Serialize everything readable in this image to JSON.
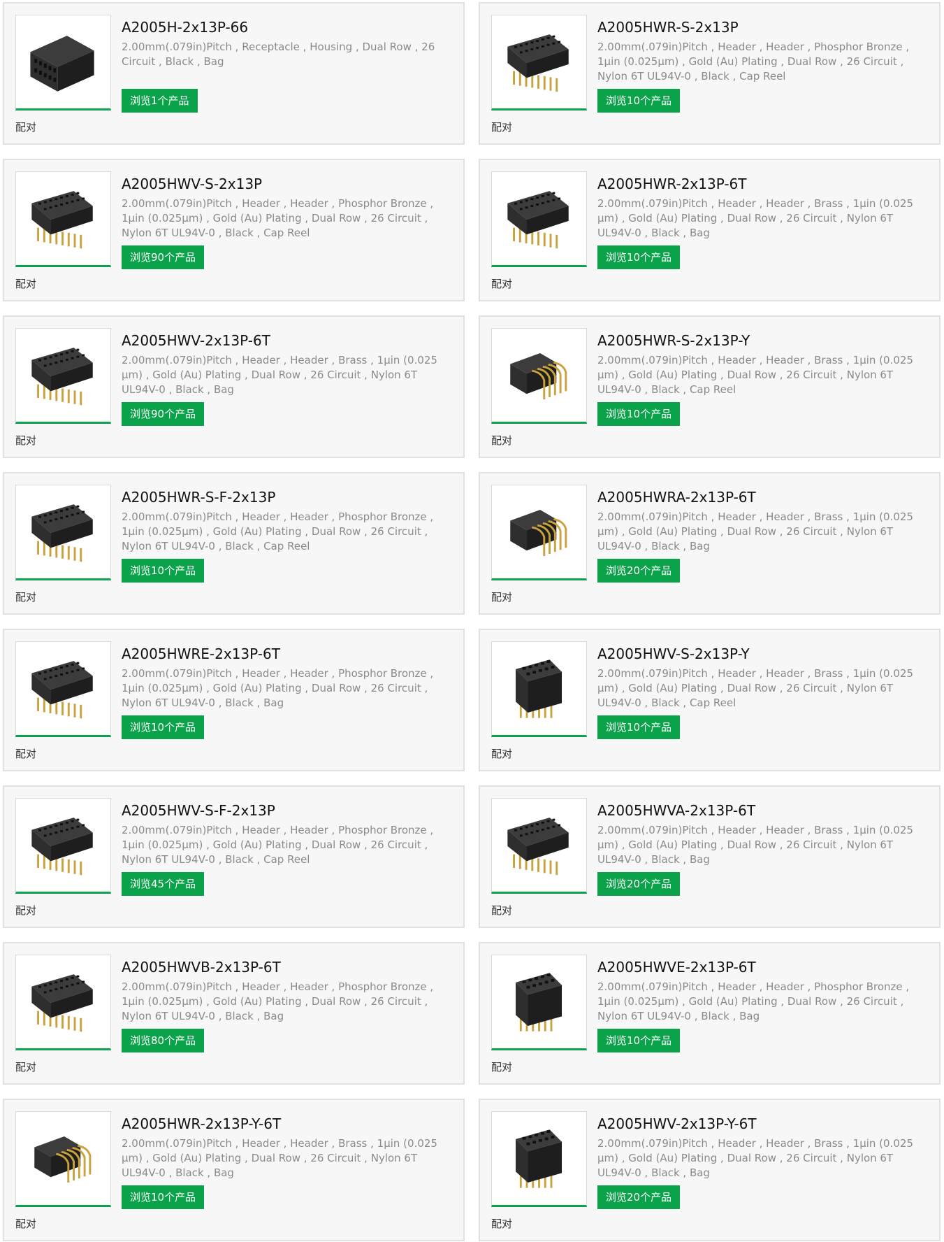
{
  "match_label": "配对",
  "accent_color": "#0aa34a",
  "products": [
    {
      "name": "A2005H-2x13P-66",
      "desc": "2.00mm(.079in)Pitch , Receptacle , Housing , Dual Row , 26 Circuit , Black , Bag",
      "button": "浏览1个产品",
      "icon": "connector-housing-icon"
    },
    {
      "name": "A2005HWR-S-2x13P",
      "desc": "2.00mm(.079in)Pitch , Header , Header , Phosphor Bronze , 1μin (0.025μm) , Gold (Au) Plating , Dual Row , 26 Circuit , Nylon 6T UL94V-0 , Black , Cap Reel",
      "button": "浏览10个产品",
      "icon": "connector-header-icon"
    },
    {
      "name": "A2005HWV-S-2x13P",
      "desc": "2.00mm(.079in)Pitch , Header , Header , Phosphor Bronze , 1μin (0.025μm) , Gold (Au) Plating , Dual Row , 26 Circuit , Nylon 6T UL94V-0 , Black , Cap Reel",
      "button": "浏览90个产品",
      "icon": "connector-header-icon"
    },
    {
      "name": "A2005HWR-2x13P-6T",
      "desc": "2.00mm(.079in)Pitch , Header , Header , Brass , 1μin (0.025 μm) , Gold (Au) Plating , Dual Row , 26 Circuit , Nylon 6T UL94V-0 , Black , Bag",
      "button": "浏览10个产品",
      "icon": "connector-header-icon"
    },
    {
      "name": "A2005HWV-2x13P-6T",
      "desc": "2.00mm(.079in)Pitch , Header , Header , Brass , 1μin (0.025 μm) , Gold (Au) Plating , Dual Row , 26 Circuit , Nylon 6T UL94V-0 , Black , Bag",
      "button": "浏览90个产品",
      "icon": "connector-header-icon"
    },
    {
      "name": "A2005HWR-S-2x13P-Y",
      "desc": "2.00mm(.079in)Pitch , Header , Header , Brass , 1μin (0.025 μm) , Gold (Au) Plating , Dual Row , 26 Circuit , Nylon 6T UL94V-0 , Black , Cap Reel",
      "button": "浏览10个产品",
      "icon": "connector-right-angle-icon"
    },
    {
      "name": "A2005HWR-S-F-2x13P",
      "desc": "2.00mm(.079in)Pitch , Header , Header , Phosphor Bronze , 1μin (0.025μm) , Gold (Au) Plating , Dual Row , 26 Circuit , Nylon 6T UL94V-0 , Black , Cap Reel",
      "button": "浏览10个产品",
      "icon": "connector-header-icon"
    },
    {
      "name": "A2005HWRA-2x13P-6T",
      "desc": "2.00mm(.079in)Pitch , Header , Header , Brass , 1μin (0.025 μm) , Gold (Au) Plating , Dual Row , 26 Circuit , Nylon 6T UL94V-0 , Black , Bag",
      "button": "浏览20个产品",
      "icon": "connector-right-angle-icon"
    },
    {
      "name": "A2005HWRE-2x13P-6T",
      "desc": "2.00mm(.079in)Pitch , Header , Header , Phosphor Bronze , 1μin (0.025μm) , Gold (Au) Plating , Dual Row , 26 Circuit , Nylon 6T UL94V-0 , Black , Bag",
      "button": "浏览10个产品",
      "icon": "connector-header-icon"
    },
    {
      "name": "A2005HWV-S-2x13P-Y",
      "desc": "2.00mm(.079in)Pitch , Header , Header , Brass , 1μin (0.025 μm) , Gold (Au) Plating , Dual Row , 26 Circuit , Nylon 6T UL94V-0 , Black , Cap Reel",
      "button": "浏览10个产品",
      "icon": "connector-vertical-icon"
    },
    {
      "name": "A2005HWV-S-F-2x13P",
      "desc": "2.00mm(.079in)Pitch , Header , Header , Phosphor Bronze , 1μin (0.025μm) , Gold (Au) Plating , Dual Row , 26 Circuit , Nylon 6T UL94V-0 , Black , Cap Reel",
      "button": "浏览45个产品",
      "icon": "connector-header-icon"
    },
    {
      "name": "A2005HWVA-2x13P-6T",
      "desc": "2.00mm(.079in)Pitch , Header , Header , Brass , 1μin (0.025 μm) , Gold (Au) Plating , Dual Row , 26 Circuit , Nylon 6T UL94V-0 , Black , Bag",
      "button": "浏览20个产品",
      "icon": "connector-header-icon"
    },
    {
      "name": "A2005HWVB-2x13P-6T",
      "desc": "2.00mm(.079in)Pitch , Header , Header , Phosphor Bronze , 1μin (0.025μm) , Gold (Au) Plating , Dual Row , 26 Circuit , Nylon 6T UL94V-0 , Black , Bag",
      "button": "浏览80个产品",
      "icon": "connector-header-icon"
    },
    {
      "name": "A2005HWVE-2x13P-6T",
      "desc": "2.00mm(.079in)Pitch , Header , Header , Phosphor Bronze , 1μin (0.025μm) , Gold (Au) Plating , Dual Row , 26 Circuit , Nylon 6T UL94V-0 , Black , Bag",
      "button": "浏览10个产品",
      "icon": "connector-vertical-icon"
    },
    {
      "name": "A2005HWR-2x13P-Y-6T",
      "desc": "2.00mm(.079in)Pitch , Header , Header , Brass , 1μin (0.025 μm) , Gold (Au) Plating , Dual Row , 26 Circuit , Nylon 6T UL94V-0 , Black , Bag",
      "button": "浏览10个产品",
      "icon": "connector-right-angle-icon"
    },
    {
      "name": "A2005HWV-2x13P-Y-6T",
      "desc": "2.00mm(.079in)Pitch , Header , Header , Brass , 1μin (0.025 μm) , Gold (Au) Plating , Dual Row , 26 Circuit , Nylon 6T UL94V-0 , Black , Bag",
      "button": "浏览20个产品",
      "icon": "connector-vertical-icon"
    }
  ]
}
